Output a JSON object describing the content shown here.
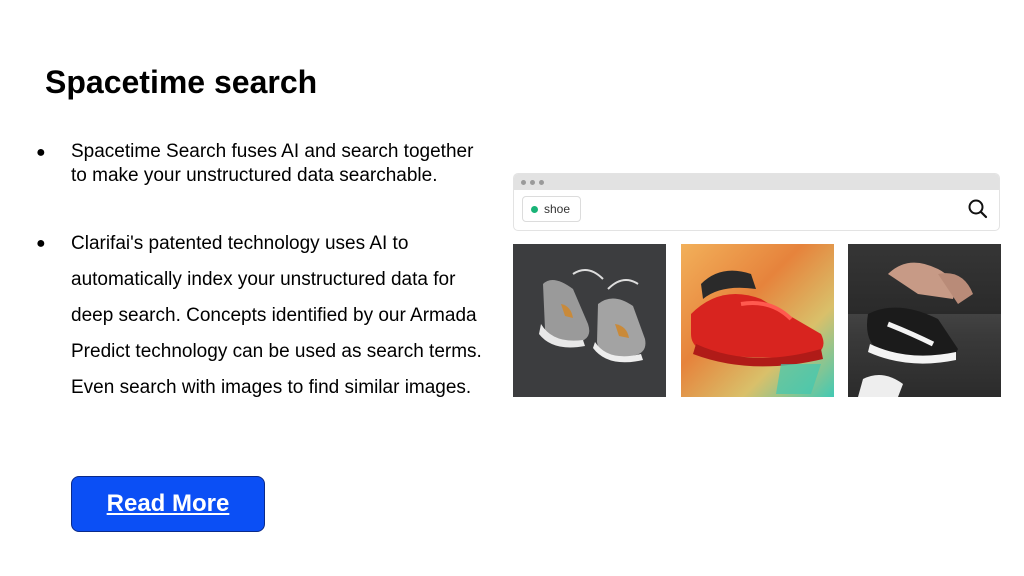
{
  "slide": {
    "title": "Spacetime search",
    "bullets": [
      {
        "marker": "●",
        "text": "Spacetime Search fuses AI and search together to make your unstructured data searchable."
      },
      {
        "marker": "●",
        "text": "Clarifai's patented technology uses AI to automatically index your unstructured data for deep search. Concepts identified by our Armada Predict technology can be used as search terms. Even search with images to find similar images."
      }
    ],
    "read_more_label": "Read More"
  },
  "search_demo": {
    "tag_label": "shoe",
    "icons": {
      "search": "search-icon",
      "window_dots": "window-dots-icon"
    },
    "results": [
      {
        "name": "grey-sneakers-image"
      },
      {
        "name": "red-sneakers-image"
      },
      {
        "name": "black-sneakers-image"
      }
    ]
  },
  "colors": {
    "button": "#0b4ff5",
    "tag_dot": "#19b377"
  }
}
